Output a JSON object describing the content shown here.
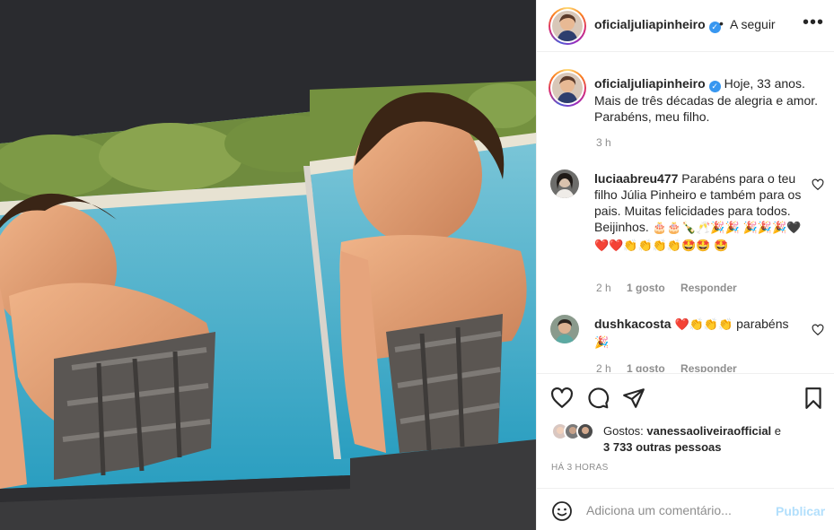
{
  "header": {
    "username": "oficialjuliapinheiro",
    "verified_mark": "✓",
    "dot": "•",
    "follow_label": "A seguir",
    "more_label": "•••"
  },
  "caption": {
    "username": "oficialjuliapinheiro",
    "verified_mark": "✓",
    "text": "Hoje, 33 anos. Mais de três décadas de alegria e amor. Parabéns, meu filho.",
    "time": "3 h"
  },
  "comments": [
    {
      "username": "luciaabreu477",
      "text": "Parabéns para o teu filho Júlia Pinheiro e também para os pais. Muitas felicidades para todos. Beijinhos.",
      "emojis_line1": "🎂🎂🍾🥂🎉🎉",
      "emojis_line2": "🎉🎉🎉🖤❤️❤️👏👏👏👏🤩🤩",
      "emojis_line3": "🤩",
      "time": "2 h",
      "likes": "1 gosto",
      "reply": "Responder"
    },
    {
      "username": "dushkacosta",
      "text_pre": "❤️👏👏👏",
      "text": "parabéns",
      "emojis_line2": "🎉",
      "time": "2 h",
      "likes": "1 gosto",
      "reply": "Responder"
    }
  ],
  "likes": {
    "prefix": "Gostos:",
    "user": "vanessaoliveiraofficial",
    "connector": "e",
    "others": "3 733 outras pessoas"
  },
  "post_time": "HÁ 3 HORAS",
  "add_comment": {
    "placeholder": "Adiciona um comentário...",
    "publish_label": "Publicar"
  },
  "colors": {
    "verified": "#3897f0",
    "publish_disabled": "#b2dffc",
    "meta": "#8e8e8e",
    "text": "#262626"
  }
}
